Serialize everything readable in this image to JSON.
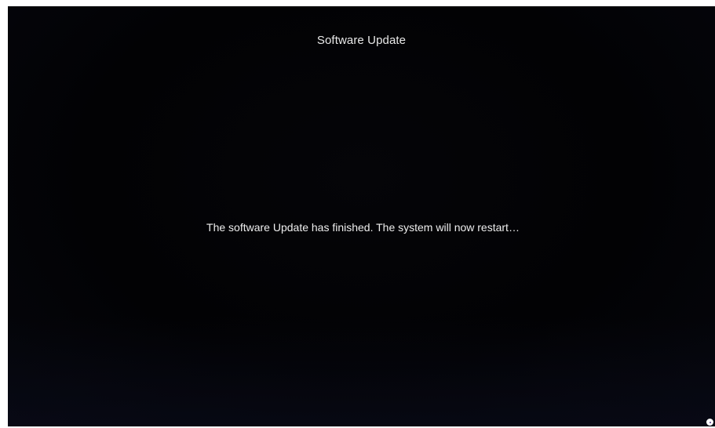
{
  "screen": {
    "title": "Software Update",
    "message": "The software Update has finished. The system will now restart…",
    "background_color": "#020204",
    "text_color": "#eeeeee"
  },
  "overlay": {
    "corner_icon": "record-indicator-icon"
  }
}
